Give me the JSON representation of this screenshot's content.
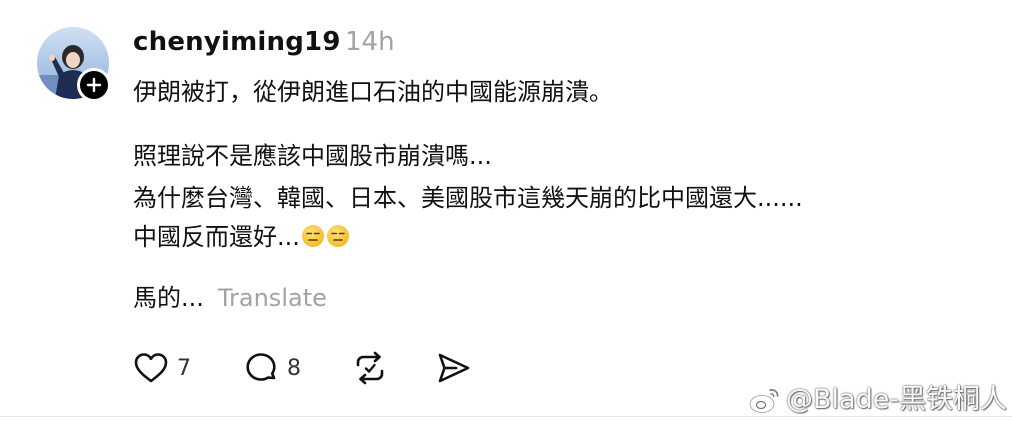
{
  "post": {
    "username": "chenyiming19",
    "timestamp": "14h",
    "lines": {
      "line1": "伊朗被打，從伊朗進口石油的中國能源崩潰。",
      "line2": "照理說不是應該中國股市崩潰嗎...",
      "line3": "為什麼台灣、韓國、日本、美國股市這幾天崩的比中國還大......",
      "line4": "中國反而還好...",
      "line5": "馬的..."
    },
    "translate_label": "Translate",
    "like_count": "7",
    "reply_count": "8"
  },
  "watermark": {
    "text": "@Blade-黑铁桐人"
  },
  "icons": {
    "like": "heart-icon",
    "reply": "speech-bubble-icon",
    "repost": "repost-icon",
    "share": "send-icon",
    "follow": "plus-icon",
    "emoji": "expressionless-face-emoji",
    "watermark": "weibo-logo-icon"
  }
}
